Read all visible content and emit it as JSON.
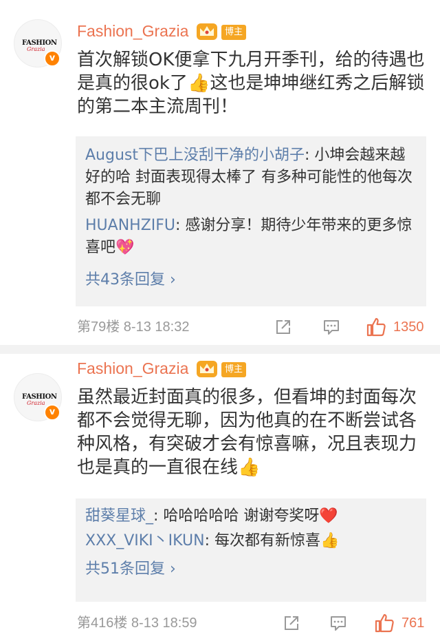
{
  "comments": [
    {
      "author": "Fashion_Grazia",
      "tag": "博主",
      "avatar_text": "FASHION",
      "avatar_sub": "Grazia",
      "text": "首次解锁OK便拿下九月开季刊，给的待遇也是真的很ok了👍这也是坤坤继红秀之后解锁的第二本主流周刊！",
      "replies": [
        {
          "name": "August下巴上没刮干净的小胡子",
          "text": ": 小坤会越来越好的哈 封面表现得太棒了 有多种可能性的他每次都不会无聊"
        },
        {
          "name": "HUANHZIFU",
          "text": ": 感谢分享！期待少年带来的更多惊喜吧💖"
        }
      ],
      "more_replies": "共43条回复 ›",
      "floor": "第79楼  8-13 18:32",
      "likes": "1350"
    },
    {
      "author": "Fashion_Grazia",
      "tag": "博主",
      "avatar_text": "FASHION",
      "avatar_sub": "Grazia",
      "text": "虽然最近封面真的很多，但看坤的封面每次都不会觉得无聊，因为他真的在不断尝试各种风格，有突破才会有惊喜嘛，况且表现力也是真的一直很在线👍",
      "replies": [
        {
          "name": "甜葵星球_",
          "text": ": 哈哈哈哈哈 谢谢夸奖呀❤️"
        },
        {
          "name": "XXX_VIKI丶IKUN",
          "text": ": 每次都有新惊喜👍"
        }
      ],
      "more_replies": "共51条回复 ›",
      "floor": "第416楼  8-13 18:59",
      "likes": "761"
    }
  ],
  "colors": {
    "accent": "#eb7350",
    "link": "#5d7eaa",
    "badge": "#f5a623",
    "vip": "#ff8200"
  },
  "icons": [
    "share-icon",
    "comment-icon",
    "like-icon",
    "crown-icon",
    "verified-icon"
  ]
}
